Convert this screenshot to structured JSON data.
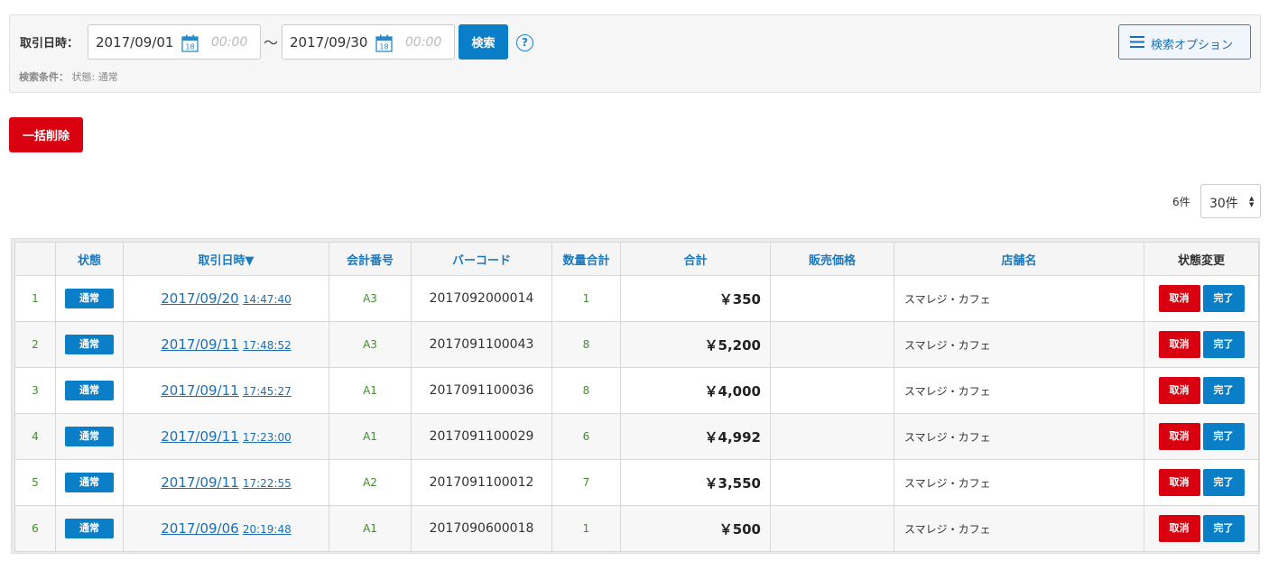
{
  "search": {
    "date_label": "取引日時：",
    "from_date": "2017/09/01",
    "from_time_placeholder": "00:00",
    "to_date": "2017/09/30",
    "to_time_placeholder": "00:00",
    "calendar_day": "18",
    "separator": "〜",
    "search_label": "検索",
    "help_label": "?",
    "options_label": "検索オプション",
    "condition_label": "検索条件：",
    "condition_value": "状態: 通常"
  },
  "actions": {
    "bulk_delete_label": "一括削除"
  },
  "pagination": {
    "count": "6件",
    "per_page": "30件"
  },
  "table": {
    "headers": [
      "",
      "状態",
      "取引日時▼",
      "会計番号",
      "バーコード",
      "数量合計",
      "合計",
      "販売価格",
      "店舗名",
      "状態変更"
    ],
    "rows": [
      {
        "no": "1",
        "status": "通常",
        "date": "2017/09/20",
        "time": "14:47:40",
        "account": "A3",
        "barcode": "2017092000014",
        "qty": "1",
        "total": "￥350",
        "price": "",
        "store": "スマレジ・カフェ",
        "cancel": "取消",
        "done": "完了"
      },
      {
        "no": "2",
        "status": "通常",
        "date": "2017/09/11",
        "time": "17:48:52",
        "account": "A3",
        "barcode": "2017091100043",
        "qty": "8",
        "total": "￥5,200",
        "price": "",
        "store": "スマレジ・カフェ",
        "cancel": "取消",
        "done": "完了"
      },
      {
        "no": "3",
        "status": "通常",
        "date": "2017/09/11",
        "time": "17:45:27",
        "account": "A1",
        "barcode": "2017091100036",
        "qty": "8",
        "total": "￥4,000",
        "price": "",
        "store": "スマレジ・カフェ",
        "cancel": "取消",
        "done": "完了"
      },
      {
        "no": "4",
        "status": "通常",
        "date": "2017/09/11",
        "time": "17:23:00",
        "account": "A1",
        "barcode": "2017091100029",
        "qty": "6",
        "total": "￥4,992",
        "price": "",
        "store": "スマレジ・カフェ",
        "cancel": "取消",
        "done": "完了"
      },
      {
        "no": "5",
        "status": "通常",
        "date": "2017/09/11",
        "time": "17:22:55",
        "account": "A2",
        "barcode": "2017091100012",
        "qty": "7",
        "total": "￥3,550",
        "price": "",
        "store": "スマレジ・カフェ",
        "cancel": "取消",
        "done": "完了"
      },
      {
        "no": "6",
        "status": "通常",
        "date": "2017/09/06",
        "time": "20:19:48",
        "account": "A1",
        "barcode": "2017090600018",
        "qty": "1",
        "total": "￥500",
        "price": "",
        "store": "スマレジ・カフェ",
        "cancel": "取消",
        "done": "完了"
      }
    ]
  },
  "colors": {
    "primary": "#0a7fc8",
    "danger": "#d9000f",
    "link": "#1a6fb5",
    "green": "#3f8f2a"
  }
}
